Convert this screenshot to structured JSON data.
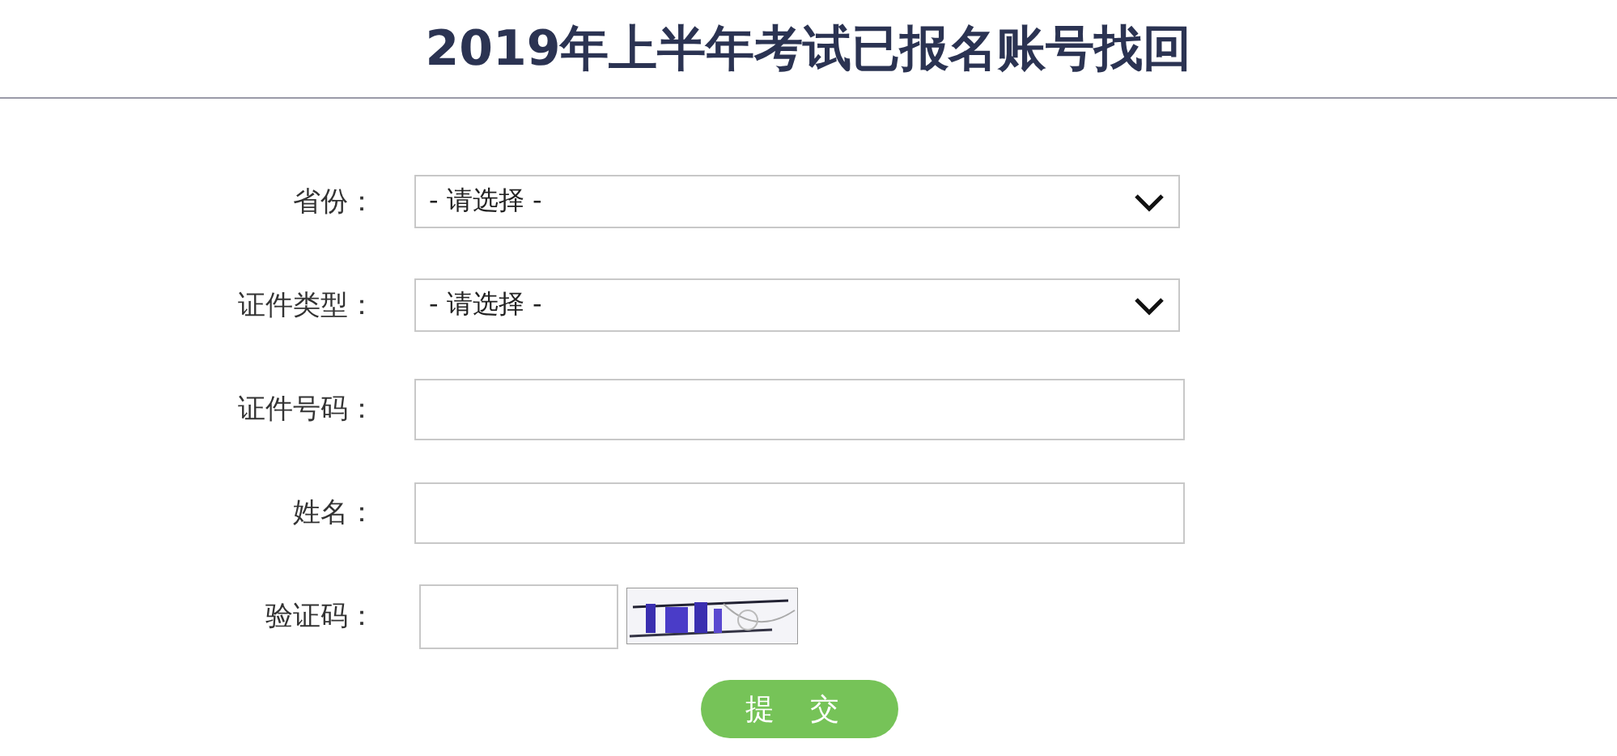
{
  "title": "2019年上半年考试已报名账号找回",
  "fields": [
    {
      "label": "省份：",
      "kind": "select",
      "value": "- 请选择 -"
    },
    {
      "label": "证件类型：",
      "kind": "select",
      "value": "- 请选择 -"
    },
    {
      "label": "证件号码：",
      "kind": "text"
    },
    {
      "label": "姓名：",
      "kind": "text"
    },
    {
      "label": "验证码：",
      "kind": "captcha"
    }
  ],
  "submit": "提 交"
}
